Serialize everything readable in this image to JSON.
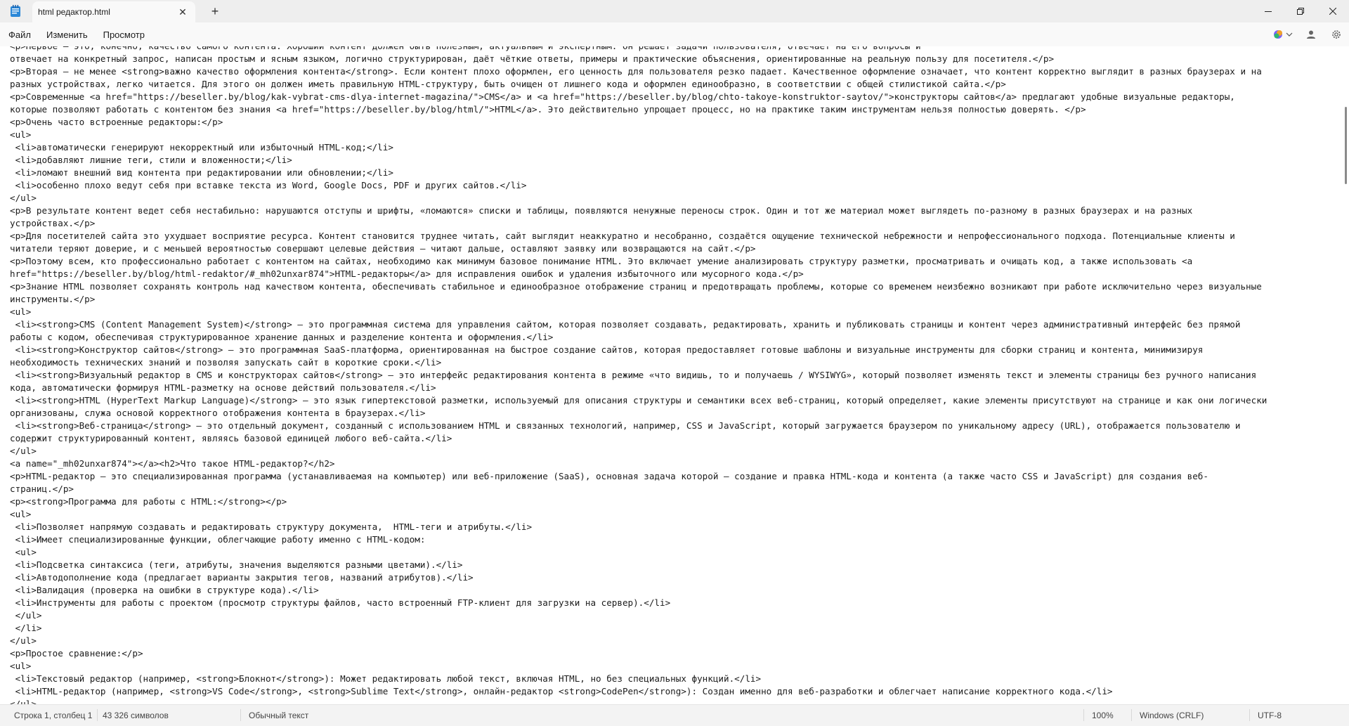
{
  "window": {
    "tab_title": "html редактор.html",
    "new_tab_symbol": "+",
    "close_tab_symbol": "✕"
  },
  "menu": {
    "items": [
      "Файл",
      "Изменить",
      "Просмотр"
    ]
  },
  "editor": {
    "lines": [
      "<p>Первое — это, конечно, качество самого контента. Хороший контент должен быть полезным, актуальным и экспертным. Он решает задачи пользователя, отвечает на его вопросы и",
      "отвечает на конкретный запрос, написан простым и ясным языком, логично структурирован, даёт чёткие ответы, примеры и практические объяснения, ориентированные на реальную пользу для посетителя.</p>",
      "<p>Вторая — не менее <strong>важно качество оформления контента</strong>. Если контент плохо оформлен, его ценность для пользователя резко падает. Качественное оформление означает, что контент корректно выглядит в разных браузерах и на",
      "разных устройствах, легко читается. Для этого он должен иметь правильную HTML-структуру, быть очищен от лишнего кода и оформлен единообразно, в соответствии с общей стилистикой сайта.</p>",
      "<p>Современные <a href=\"https://beseller.by/blog/kak-vybrat-cms-dlya-internet-magazina/\">CMS</a> и <a href=\"https://beseller.by/blog/chto-takoye-konstruktor-saytov/\">конструкторы сайтов</a> предлагают удобные визуальные редакторы,",
      "которые позволяют работать с контентом без знания <a href=\"https://beseller.by/blog/html/\">HTML</a>. Это действительно упрощает процесс, но на практике таким инструментам нельзя полностью доверять. </p>",
      "<p>Очень часто встроенные редакторы:</p>",
      "<ul>",
      " <li>автоматически генерируют некорректный или избыточный HTML-код;</li>",
      " <li>добавляют лишние теги, стили и вложенности;</li>",
      " <li>ломают внешний вид контента при редактировании или обновлении;</li>",
      " <li>особенно плохо ведут себя при вставке текста из Word, Google Docs, PDF и других сайтов.</li>",
      "</ul>",
      "<p>В результате контент ведет себя нестабильно: нарушаются отступы и шрифты, «ломаются» списки и таблицы, появляются ненужные переносы строк. Один и тот же материал может выглядеть по-разному в разных браузерах и на разных",
      "устройствах.</p>",
      "<p>Для посетителей сайта это ухудшает восприятие ресурса. Контент становится труднее читать, сайт выглядит неаккуратно и несобранно, создаётся ощущение технической небрежности и непрофессионального подхода. Потенциальные клиенты и",
      "читатели теряют доверие, и с меньшей вероятностью совершают целевые действия — читают дальше, оставляют заявку или возвращаются на сайт.</p>",
      "<p>Поэтому всем, кто профессионально работает с контентом на сайтах, необходимо как минимум базовое понимание HTML. Это включает умение анализировать структуру разметки, просматривать и очищать код, а также использовать <a",
      "href=\"https://beseller.by/blog/html-redaktor/#_mh02unxar874\">HTML-редакторы</a> для исправления ошибок и удаления избыточного или мусорного кода.</p>",
      "<p>Знание HTML позволяет сохранять контроль над качеством контента, обеспечивать стабильное и единообразное отображение страниц и предотвращать проблемы, которые со временем неизбежно возникают при работе исключительно через визуальные",
      "инструменты.</p>",
      "<ul>",
      " <li><strong>CMS (Content Management System)</strong> — это программная система для управления сайтом, которая позволяет создавать, редактировать, хранить и публиковать страницы и контент через административный интерфейс без прямой",
      "работы с кодом, обеспечивая структурированное хранение данных и разделение контента и оформления.</li>",
      " <li><strong>Конструктор сайтов</strong> — это программная SaaS-платформа, ориентированная на быстрое создание сайтов, которая предоставляет готовые шаблоны и визуальные инструменты для сборки страниц и контента, минимизируя",
      "необходимость технических знаний и позволяя запускать сайт в короткие сроки.</li>",
      " <li><strong>Визуальный редактор в CMS и конструкторах сайтов</strong> — это интерфейс редактирования контента в режиме «что видишь, то и получаешь / WYSIWYG», который позволяет изменять текст и элементы страницы без ручного написания",
      "кода, автоматически формируя HTML-разметку на основе действий пользователя.</li>",
      " <li><strong>HTML (HyperText Markup Language)</strong> — это язык гипертекстовой разметки, используемый для описания структуры и семантики всех веб-страниц, который определяет, какие элементы присутствуют на странице и как они логически",
      "организованы, служа основой корректного отображения контента в браузерах.</li>",
      " <li><strong>Веб-страница</strong> — это отдельный документ, созданный с использованием HTML и связанных технологий, например, CSS и JavaScript, который загружается браузером по уникальному адресу (URL), отображается пользователю и",
      "содержит структурированный контент, являясь базовой единицей любого веб-сайта.</li>",
      "</ul>",
      "<a name=\"_mh02unxar874\"></a><h2>Что такое HTML-редактор?</h2>",
      "<p>HTML-редактор — это специализированная программа (устанавливаемая на компьютер) или веб-приложение (SaaS), основная задача которой — создание и правка HTML-кода и контента (а также часто CSS и JavaScript) для создания веб-",
      "страниц.</p>",
      "<p><strong>Программа для работы с HTML:</strong></p>",
      "<ul>",
      " <li>Позволяет напрямую создавать и редактировать структуру документа,  HTML-теги и атрибуты.</li>",
      " <li>Имеет специализированные функции, облегчающие работу именно с HTML-кодом:",
      " <ul>",
      " <li>Подсветка синтаксиса (теги, атрибуты, значения выделяются разными цветами).</li>",
      " <li>Автодополнение кода (предлагает варианты закрытия тегов, названий атрибутов).</li>",
      " <li>Валидация (проверка на ошибки в структуре кода).</li>",
      " <li>Инструменты для работы с проектом (просмотр структуры файлов, часто встроенный FTP-клиент для загрузки на сервер).</li>",
      " </ul>",
      " </li>",
      "</ul>",
      "<p>Простое сравнение:</p>",
      "<ul>",
      " <li>Текстовый редактор (например, <strong>Блокнот</strong>): Может редактировать любой текст, включая HTML, но без специальных функций.</li>",
      " <li>HTML-редактор (например, <strong>VS Code</strong>, <strong>Sublime Text</strong>, онлайн-редактор <strong>CodePen</strong>): Создан именно для веб-разработки и облегчает написание корректного кода.</li>",
      "</ul>"
    ]
  },
  "status": {
    "position": "Строка 1, столбец 1",
    "chars": "43 326 символов",
    "format": "Обычный текст",
    "zoom": "100%",
    "line_ending": "Windows (CRLF)",
    "encoding": "UTF-8"
  }
}
